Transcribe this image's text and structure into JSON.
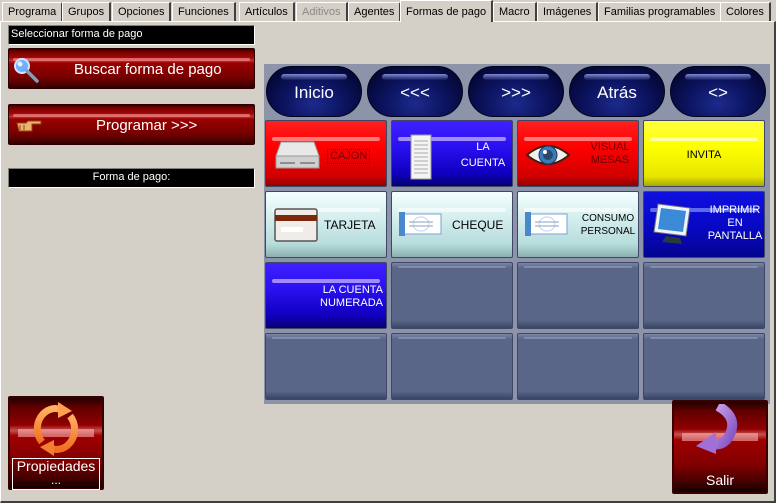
{
  "tabs": [
    {
      "label": "Programa",
      "state": "normal"
    },
    {
      "label": "Grupos",
      "state": "normal"
    },
    {
      "label": "Opciones",
      "state": "normal"
    },
    {
      "label": "Funciones",
      "state": "normal"
    },
    {
      "label": "Artículos",
      "state": "normal"
    },
    {
      "label": "Aditivos",
      "state": "disabled"
    },
    {
      "label": "Agentes",
      "state": "normal"
    },
    {
      "label": "Formas de pago",
      "state": "active"
    },
    {
      "label": "Macro",
      "state": "normal"
    },
    {
      "label": "Imágenes",
      "state": "normal"
    },
    {
      "label": "Familias programables",
      "state": "normal"
    },
    {
      "label": "Colores",
      "state": "normal"
    }
  ],
  "left_panel": {
    "select_label": "Seleccionar forma de pago",
    "search_button": {
      "label": "Buscar forma de pago",
      "icon": "magnifier-icon"
    },
    "program_button": {
      "label": "Programar >>>",
      "icon": "pointing-hand-icon"
    },
    "payment_field_label": "Forma de pago:"
  },
  "nav_buttons": [
    {
      "label": "Inicio"
    },
    {
      "label": "<<<"
    },
    {
      "label": ">>>"
    },
    {
      "label": "Atrás"
    },
    {
      "label": "<>"
    }
  ],
  "grid": [
    {
      "line1": "CAJON",
      "line2": "",
      "line3": "",
      "color": "red",
      "icon": "drawer-icon",
      "focused": true
    },
    {
      "line1": "LA",
      "line2": "CUENTA",
      "line3": "",
      "color": "blue",
      "icon": "receipt-icon"
    },
    {
      "line1": "VISUAL",
      "line2": "MESAS",
      "line3": "",
      "color": "red",
      "icon": "eye-icon"
    },
    {
      "line1": "INVITA",
      "line2": "",
      "line3": "",
      "color": "yellow",
      "icon": ""
    },
    {
      "line1": "TARJETA",
      "line2": "",
      "line3": "",
      "color": "cyan",
      "icon": "credit-card-icon"
    },
    {
      "line1": "CHEQUE",
      "line2": "",
      "line3": "",
      "color": "cyan",
      "icon": "check-icon"
    },
    {
      "line1": "CONSUMO",
      "line2": "PERSONAL",
      "line3": "",
      "color": "cyan",
      "icon": "check-icon"
    },
    {
      "line1": "IMPRIMIR",
      "line2": "EN",
      "line3": "PANTALLA",
      "color": "navy",
      "icon": "monitor-icon"
    },
    {
      "line1": "LA CUENTA",
      "line2": "NUMERADA",
      "line3": "",
      "color": "blue",
      "icon": ""
    },
    {
      "line1": "",
      "color": "empty"
    },
    {
      "line1": "",
      "color": "empty"
    },
    {
      "line1": "",
      "color": "empty"
    },
    {
      "line1": "",
      "color": "empty"
    },
    {
      "line1": "",
      "color": "empty"
    },
    {
      "line1": "",
      "color": "empty"
    },
    {
      "line1": "",
      "color": "empty"
    }
  ],
  "bottom": {
    "properties_button": {
      "label": "Propiedades",
      "sub": "...",
      "icon": "refresh-arrows-icon"
    },
    "exit_button": {
      "label": "Salir",
      "icon": "curved-arrow-icon"
    }
  }
}
